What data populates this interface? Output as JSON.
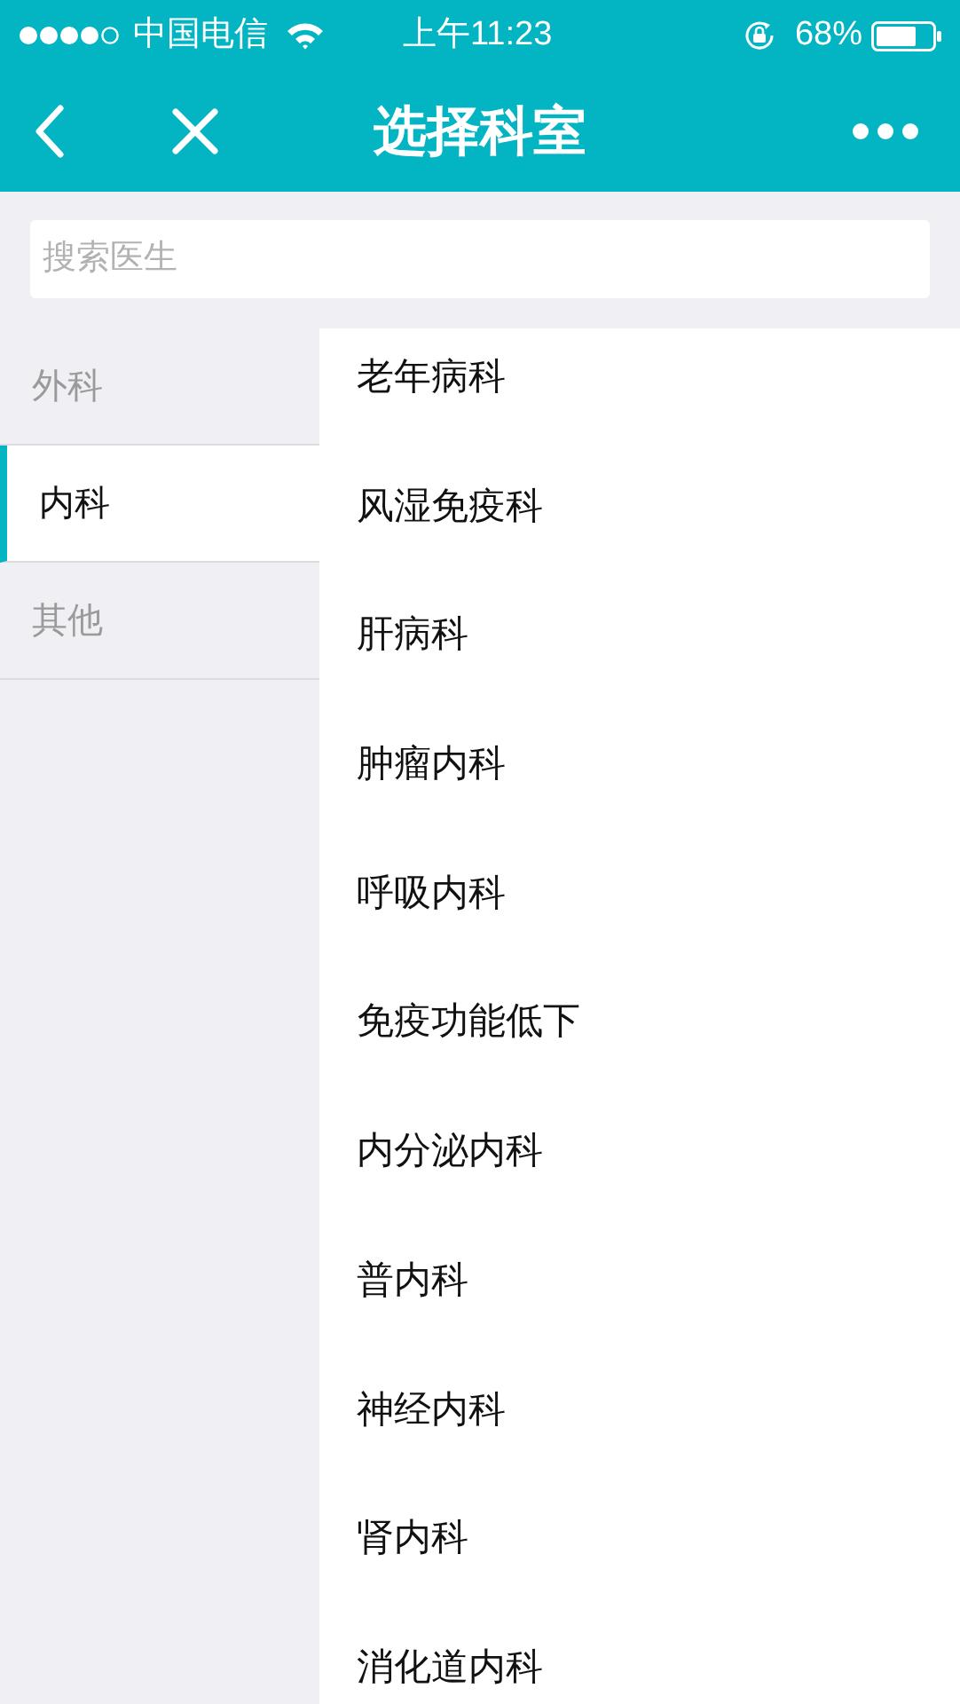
{
  "status_bar": {
    "carrier": "中国电信",
    "time": "上午11:23",
    "battery": "68%"
  },
  "nav_bar": {
    "title": "选择科室"
  },
  "search": {
    "placeholder": "搜索医生"
  },
  "categories": [
    {
      "label": "外科",
      "selected": false
    },
    {
      "label": "内科",
      "selected": true
    },
    {
      "label": "其他",
      "selected": false
    }
  ],
  "departments": [
    "老年病科",
    "风湿免疫科",
    "肝病科",
    "肿瘤内科",
    "呼吸内科",
    "免疫功能低下",
    "内分泌内科",
    "普内科",
    "神经内科",
    "肾内科",
    "消化道内科"
  ]
}
